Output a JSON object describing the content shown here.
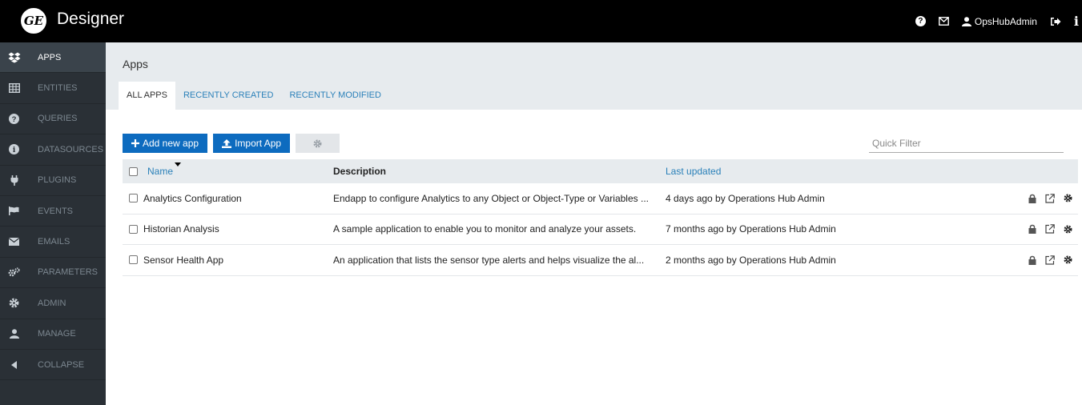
{
  "header": {
    "logo_text": "GE",
    "title": "Designer",
    "user_name": "OpsHubAdmin"
  },
  "sidebar": {
    "items": [
      {
        "label": "APPS",
        "icon": "dropbox-icon"
      },
      {
        "label": "ENTITIES",
        "icon": "table-icon"
      },
      {
        "label": "QUERIES",
        "icon": "question-circle-icon"
      },
      {
        "label": "DATASOURCES",
        "icon": "info-circle-icon"
      },
      {
        "label": "PLUGINS",
        "icon": "plug-icon"
      },
      {
        "label": "EVENTS",
        "icon": "flag-icon"
      },
      {
        "label": "EMAILS",
        "icon": "envelope-icon"
      },
      {
        "label": "PARAMETERS",
        "icon": "cogs-icon"
      },
      {
        "label": "ADMIN",
        "icon": "gear-icon"
      },
      {
        "label": "MANAGE",
        "icon": "user-icon"
      },
      {
        "label": "COLLAPSE",
        "icon": "caret-left-icon"
      }
    ]
  },
  "main": {
    "title": "Apps",
    "tabs": [
      "ALL APPS",
      "RECENTLY CREATED",
      "RECENTLY MODIFIED"
    ],
    "toolbar": {
      "add_label": "Add new app",
      "import_label": "Import App"
    },
    "filter": {
      "placeholder": "Quick Filter",
      "value": ""
    },
    "table": {
      "columns": [
        "Name",
        "Description",
        "Last updated"
      ],
      "rows": [
        {
          "name": "Analytics Configuration",
          "description": "Endapp to configure Analytics to any Object or Object-Type or Variables ...",
          "updated": "4 days ago by Operations Hub Admin"
        },
        {
          "name": "Historian Analysis",
          "description": "A sample application to enable you to monitor and analyze your assets.",
          "updated": "7 months ago by Operations Hub Admin"
        },
        {
          "name": "Sensor Health App",
          "description": "An application that lists the sensor type alerts and helps visualize the al...",
          "updated": "2 months ago by Operations Hub Admin"
        }
      ]
    }
  },
  "colors": {
    "topbar": "#000000",
    "sidebar": "#2a3036",
    "sidebar_active": "#3a434b",
    "accent_button": "#0d6bbf",
    "link": "#2a80b9",
    "header_bg": "#e7ebee"
  }
}
